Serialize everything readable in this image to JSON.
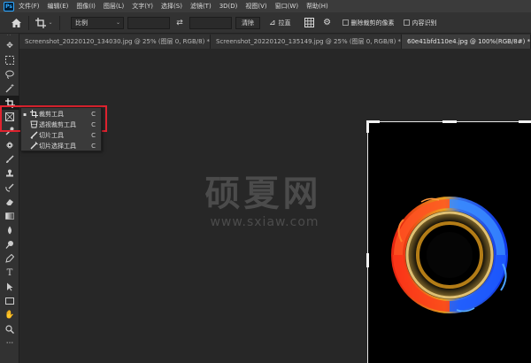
{
  "app": {
    "logo": "Ps"
  },
  "menubar": {
    "items": [
      "文件(F)",
      "编辑(E)",
      "图像(I)",
      "图层(L)",
      "文字(Y)",
      "选择(S)",
      "滤镜(T)",
      "3D(D)",
      "视图(V)",
      "窗口(W)",
      "帮助(H)"
    ]
  },
  "options": {
    "ratio_value": "比例",
    "swap_icon": "swap-arrows-icon",
    "clear_label": "清除",
    "straighten_label": "拉直",
    "delete_cropped_label": "删除裁剪的像素",
    "content_aware_label": "内容识别"
  },
  "tabs": [
    {
      "label": "Screenshot_20220120_134030.jpg @ 25% (图层 0, RGB/8) *",
      "close": "×"
    },
    {
      "label": "Screenshot_20220120_135149.jpg @ 25% (图层 0, RGB/8) *",
      "close": "×"
    },
    {
      "label": "60e41bfd110e4.jpg @ 100%(RGB/8#) *",
      "close": "×"
    }
  ],
  "tools": [
    "move-icon",
    "marquee-icon",
    "lasso-icon",
    "magic-wand-icon",
    "crop-icon",
    "frame-icon",
    "eyedropper-icon",
    "healing-icon",
    "brush-icon",
    "stamp-icon",
    "history-brush-icon",
    "eraser-icon",
    "gradient-icon",
    "blur-icon",
    "dodge-icon",
    "pen-icon",
    "type-icon",
    "path-select-icon",
    "rectangle-icon",
    "hand-icon",
    "zoom-icon",
    "more-icon"
  ],
  "flyout": {
    "items": [
      {
        "label": "裁剪工具",
        "key": "C",
        "selected": true,
        "icon": "crop-icon"
      },
      {
        "label": "透视裁剪工具",
        "key": "C",
        "selected": false,
        "icon": "perspective-crop-icon"
      },
      {
        "label": "切片工具",
        "key": "C",
        "selected": false,
        "icon": "slice-icon"
      },
      {
        "label": "切片选择工具",
        "key": "C",
        "selected": false,
        "icon": "slice-select-icon"
      }
    ]
  },
  "watermark": {
    "title": "硕夏网",
    "url": "www.sxiaw.com"
  },
  "colors": {
    "highlight": "#e0232f",
    "ring_red": "#ff3a1a",
    "ring_blue": "#1e5cff",
    "ring_gold": "#ffb020"
  }
}
